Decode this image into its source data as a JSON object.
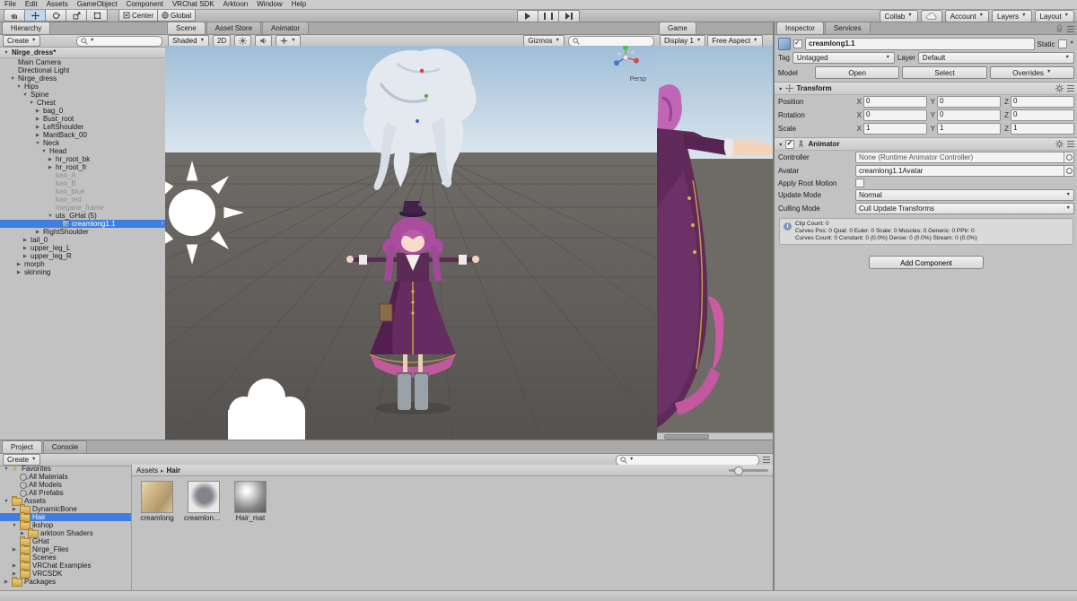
{
  "colors": {
    "selection": "#3e7fe1"
  },
  "menubar": {
    "items": [
      "File",
      "Edit",
      "Assets",
      "GameObject",
      "Component",
      "VRChat SDK",
      "Arktoon",
      "Window",
      "Help"
    ]
  },
  "toolbar": {
    "pivot": "Center",
    "space": "Global",
    "collab": "Collab",
    "account": "Account",
    "layers": "Layers",
    "layout": "Layout"
  },
  "hierarchy": {
    "tab": "Hierarchy",
    "create": "Create",
    "scene_row": {
      "label": "Nirge_dress*"
    },
    "items": [
      {
        "label": "Main Camera",
        "depth": 1,
        "arrow": "none"
      },
      {
        "label": "Directional Light",
        "depth": 1,
        "arrow": "none"
      },
      {
        "label": "Nirge_dress",
        "depth": 1,
        "arrow": "down"
      },
      {
        "label": "Hips",
        "depth": 2,
        "arrow": "down"
      },
      {
        "label": "Spine",
        "depth": 3,
        "arrow": "down"
      },
      {
        "label": "Chest",
        "depth": 4,
        "arrow": "down"
      },
      {
        "label": "bag_0",
        "depth": 5,
        "arrow": "right"
      },
      {
        "label": "Bust_root",
        "depth": 5,
        "arrow": "right"
      },
      {
        "label": "LeftShoulder",
        "depth": 5,
        "arrow": "right"
      },
      {
        "label": "MantBack_00",
        "depth": 5,
        "arrow": "right"
      },
      {
        "label": "Neck",
        "depth": 5,
        "arrow": "down"
      },
      {
        "label": "Head",
        "depth": 6,
        "arrow": "down"
      },
      {
        "label": "hr_root_bk",
        "depth": 7,
        "arrow": "right"
      },
      {
        "label": "hr_root_fr",
        "depth": 7,
        "arrow": "right"
      },
      {
        "label": "kao_A",
        "depth": 7,
        "arrow": "none",
        "dim": true
      },
      {
        "label": "kao_B",
        "depth": 7,
        "arrow": "none",
        "dim": true
      },
      {
        "label": "kao_blue",
        "depth": 7,
        "arrow": "none",
        "dim": true
      },
      {
        "label": "kao_red",
        "depth": 7,
        "arrow": "none",
        "dim": true
      },
      {
        "label": "megane_frame",
        "depth": 7,
        "arrow": "none",
        "dim": true
      },
      {
        "label": "uts_GHat (5)",
        "depth": 7,
        "arrow": "down"
      },
      {
        "label": "creamlong1.1",
        "depth": 8,
        "arrow": "none",
        "selected": true,
        "prefab": true,
        "icon": "prefab"
      },
      {
        "label": "RightShoulder",
        "depth": 5,
        "arrow": "right"
      },
      {
        "label": "tail_0",
        "depth": 3,
        "arrow": "right"
      },
      {
        "label": "upper_leg_L",
        "depth": 3,
        "arrow": "right"
      },
      {
        "label": "upper_leg_R",
        "depth": 3,
        "arrow": "right"
      },
      {
        "label": "morph",
        "depth": 2,
        "arrow": "right"
      },
      {
        "label": "skinning",
        "depth": 2,
        "arrow": "right"
      }
    ]
  },
  "scene": {
    "tabs": [
      {
        "label": "Scene",
        "active": true
      },
      {
        "label": "Asset Store"
      },
      {
        "label": "Animator"
      }
    ],
    "shading": "Shaded",
    "toggle_2d": "2D",
    "gizmos": "Gizmos",
    "projection": "Persp"
  },
  "game": {
    "tab": "Game",
    "display": "Display 1",
    "aspect": "Free Aspect"
  },
  "inspector": {
    "tabs": [
      {
        "label": "Inspector",
        "active": true
      },
      {
        "label": "Services"
      }
    ],
    "name": "creamlong1.1",
    "static_label": "Static",
    "tag_label": "Tag",
    "tag": "Untagged",
    "layer_label": "Layer",
    "layer": "Default",
    "model_label": "Model",
    "model_open": "Open",
    "model_select": "Select",
    "model_overrides": "Overrides",
    "transform": {
      "title": "Transform",
      "axes": [
        "X",
        "Y",
        "Z"
      ],
      "rows": [
        {
          "label": "Position",
          "x": "0",
          "y": "0",
          "z": "0"
        },
        {
          "label": "Rotation",
          "x": "0",
          "y": "0",
          "z": "0"
        },
        {
          "label": "Scale",
          "x": "1",
          "y": "1",
          "z": "1"
        }
      ]
    },
    "animator": {
      "title": "Animator",
      "controller_label": "Controller",
      "controller": "None (Runtime Animator Controller)",
      "avatar_label": "Avatar",
      "avatar": "creamlong1.1Avatar",
      "root_motion_label": "Apply Root Motion",
      "update_label": "Update Mode",
      "update": "Normal",
      "culling_label": "Culling Mode",
      "culling": "Cull Update Transforms",
      "info_lines": [
        "Clip Count: 0",
        "Curves Pos: 0 Quat: 0 Euler: 0 Scale: 0 Muscles: 0 Generic: 0 PPtr: 0",
        "Curves Count: 0 Constant: 0 (0.0%) Dense: 0 (0.0%) Stream: 0 (0.0%)"
      ]
    },
    "add_component": "Add Component"
  },
  "project": {
    "tabs": [
      {
        "label": "Project",
        "active": true
      },
      {
        "label": "Console"
      }
    ],
    "create": "Create",
    "tree": [
      {
        "label": "Favorites",
        "depth": 0,
        "arrow": "down",
        "icon": "star"
      },
      {
        "label": "All Materials",
        "depth": 1,
        "arrow": "none",
        "icon": "search"
      },
      {
        "label": "All Models",
        "depth": 1,
        "arrow": "none",
        "icon": "search"
      },
      {
        "label": "All Prefabs",
        "depth": 1,
        "arrow": "none",
        "icon": "search"
      },
      {
        "label": "Assets",
        "depth": 0,
        "arrow": "down",
        "icon": "folder"
      },
      {
        "label": "DynamicBone",
        "depth": 1,
        "arrow": "right",
        "icon": "folder"
      },
      {
        "label": "Hair",
        "depth": 1,
        "arrow": "none",
        "icon": "folder",
        "selected": true
      },
      {
        "label": "ikshop",
        "depth": 1,
        "arrow": "down",
        "icon": "folder"
      },
      {
        "label": "arktoon Shaders",
        "depth": 2,
        "arrow": "right",
        "icon": "folder"
      },
      {
        "label": "GHat",
        "depth": 1,
        "arrow": "none",
        "icon": "folder"
      },
      {
        "label": "Nirge_Files",
        "depth": 1,
        "arrow": "right",
        "icon": "folder"
      },
      {
        "label": "Scenes",
        "depth": 1,
        "arrow": "none",
        "icon": "folder"
      },
      {
        "label": "VRChat Examples",
        "depth": 1,
        "arrow": "right",
        "icon": "folder"
      },
      {
        "label": "VRCSDK",
        "depth": 1,
        "arrow": "right",
        "icon": "folder"
      },
      {
        "label": "Packages",
        "depth": 0,
        "arrow": "right",
        "icon": "folder"
      }
    ],
    "breadcrumb": {
      "root": "Assets",
      "current": "Hair"
    },
    "grid": [
      {
        "label": "creamlong",
        "thumb": "texture"
      },
      {
        "label": "creamlong1...",
        "thumb": "prefab"
      },
      {
        "label": "Hair_mat",
        "thumb": "material"
      }
    ]
  }
}
